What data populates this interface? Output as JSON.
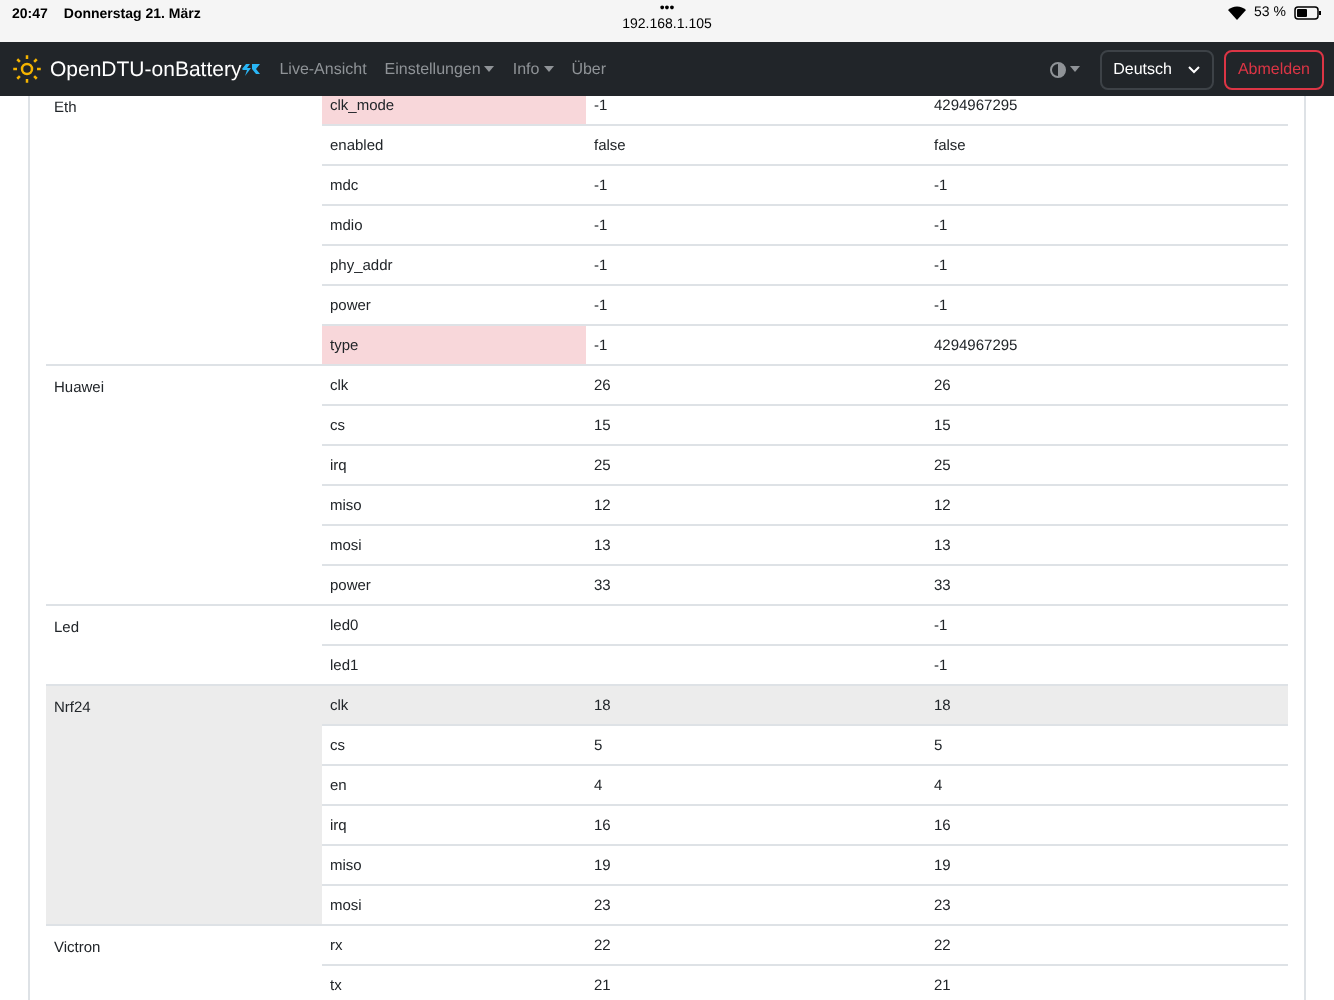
{
  "status_bar": {
    "time": "20:47",
    "date": "Donnerstag 21. März",
    "dots": "•••",
    "url": "192.168.1.105",
    "battery_text": "53 %"
  },
  "navbar": {
    "brand": "OpenDTU-onBattery",
    "links": [
      {
        "label": "Live-Ansicht",
        "dropdown": false
      },
      {
        "label": "Einstellungen",
        "dropdown": true
      },
      {
        "label": "Info",
        "dropdown": true
      },
      {
        "label": "Über",
        "dropdown": false
      }
    ],
    "language": "Deutsch",
    "logout": "Abmelden"
  },
  "table": {
    "groups": [
      {
        "name": "Eth",
        "rows": [
          {
            "key": "clk_mode",
            "value": "-1",
            "default": "4294967295",
            "mismatch": true,
            "hovered": false
          },
          {
            "key": "enabled",
            "value": "false",
            "default": "false",
            "mismatch": false,
            "hovered": false
          },
          {
            "key": "mdc",
            "value": "-1",
            "default": "-1",
            "mismatch": false,
            "hovered": false
          },
          {
            "key": "mdio",
            "value": "-1",
            "default": "-1",
            "mismatch": false,
            "hovered": false
          },
          {
            "key": "phy_addr",
            "value": "-1",
            "default": "-1",
            "mismatch": false,
            "hovered": false
          },
          {
            "key": "power",
            "value": "-1",
            "default": "-1",
            "mismatch": false,
            "hovered": false
          },
          {
            "key": "type",
            "value": "-1",
            "default": "4294967295",
            "mismatch": true,
            "hovered": false
          }
        ]
      },
      {
        "name": "Huawei",
        "rows": [
          {
            "key": "clk",
            "value": "26",
            "default": "26",
            "mismatch": false,
            "hovered": false
          },
          {
            "key": "cs",
            "value": "15",
            "default": "15",
            "mismatch": false,
            "hovered": false
          },
          {
            "key": "irq",
            "value": "25",
            "default": "25",
            "mismatch": false,
            "hovered": false
          },
          {
            "key": "miso",
            "value": "12",
            "default": "12",
            "mismatch": false,
            "hovered": false
          },
          {
            "key": "mosi",
            "value": "13",
            "default": "13",
            "mismatch": false,
            "hovered": false
          },
          {
            "key": "power",
            "value": "33",
            "default": "33",
            "mismatch": false,
            "hovered": false
          }
        ]
      },
      {
        "name": "Led",
        "rows": [
          {
            "key": "led0",
            "default": "-1",
            "mismatch": false,
            "hovered": false
          },
          {
            "key": "led1",
            "default": "-1",
            "mismatch": false,
            "hovered": false
          }
        ]
      },
      {
        "name": "Nrf24",
        "rows": [
          {
            "key": "clk",
            "value": "18",
            "default": "18",
            "mismatch": false,
            "hovered": true
          },
          {
            "key": "cs",
            "value": "5",
            "default": "5",
            "mismatch": false,
            "hovered": false
          },
          {
            "key": "en",
            "value": "4",
            "default": "4",
            "mismatch": false,
            "hovered": false
          },
          {
            "key": "irq",
            "value": "16",
            "default": "16",
            "mismatch": false,
            "hovered": false
          },
          {
            "key": "miso",
            "value": "19",
            "default": "19",
            "mismatch": false,
            "hovered": false
          },
          {
            "key": "mosi",
            "value": "23",
            "default": "23",
            "mismatch": false,
            "hovered": false
          }
        ]
      },
      {
        "name": "Victron",
        "rows": [
          {
            "key": "rx",
            "value": "22",
            "default": "22",
            "mismatch": false,
            "hovered": false
          },
          {
            "key": "tx",
            "value": "21",
            "default": "21",
            "mismatch": false,
            "hovered": false
          }
        ]
      }
    ]
  }
}
